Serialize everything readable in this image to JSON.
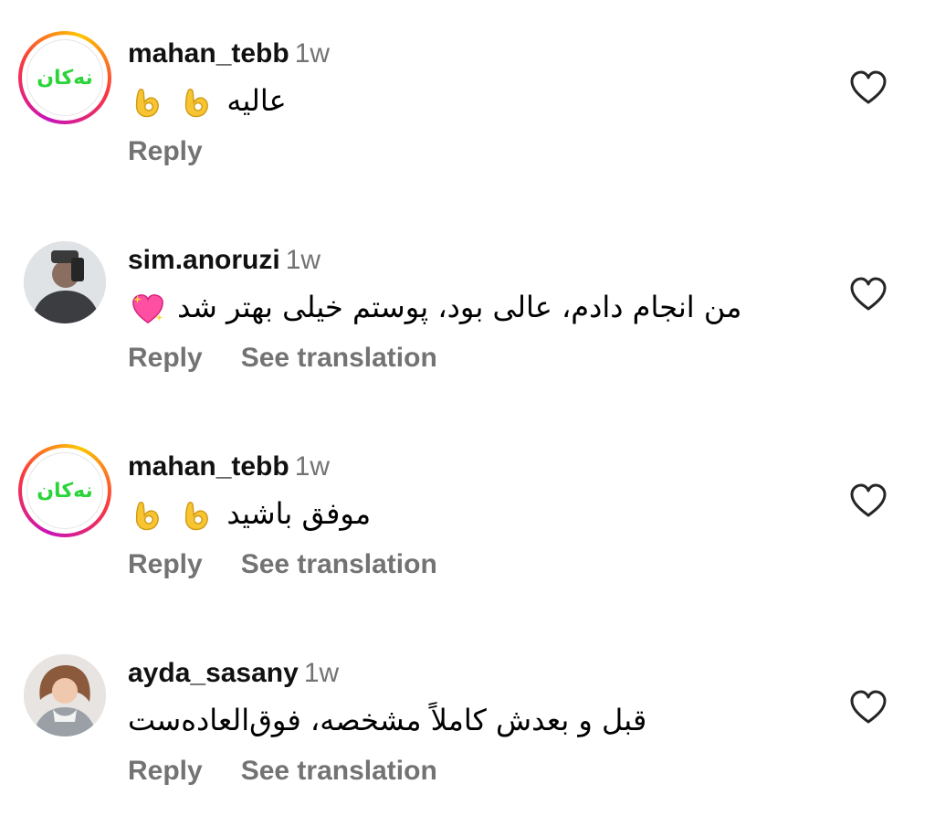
{
  "comments": [
    {
      "username": "mahan_tebb",
      "time": "1w",
      "text": "عالیه",
      "reply_label": "Reply",
      "translation_label": ""
    },
    {
      "username": "sim.anoruzi",
      "time": "1w",
      "text": "من انجام دادم، عالی بود، پوستم خیلی بهتر شد",
      "reply_label": "Reply",
      "translation_label": "See translation"
    },
    {
      "username": "mahan_tebb",
      "time": "1w",
      "text": "موفق باشید",
      "reply_label": "Reply",
      "translation_label": "See translation"
    },
    {
      "username": "ayda_sasany",
      "time": "1w",
      "text": "قبل و بعدش کاملاً مشخصه، فوق‌العاده‌ست",
      "reply_label": "Reply",
      "translation_label": "See translation"
    }
  ],
  "icons": {
    "like": "heart-icon",
    "ok_hand": "ok-hand-emoji",
    "sparkling_heart": "sparkling-heart-emoji"
  },
  "colors": {
    "meta_gray": "#737373",
    "story_ring": [
      "#c913b9",
      "#f9373f",
      "#fec600"
    ],
    "logo_green": "#2bd43a"
  },
  "logo": {
    "text": "نەکان"
  }
}
